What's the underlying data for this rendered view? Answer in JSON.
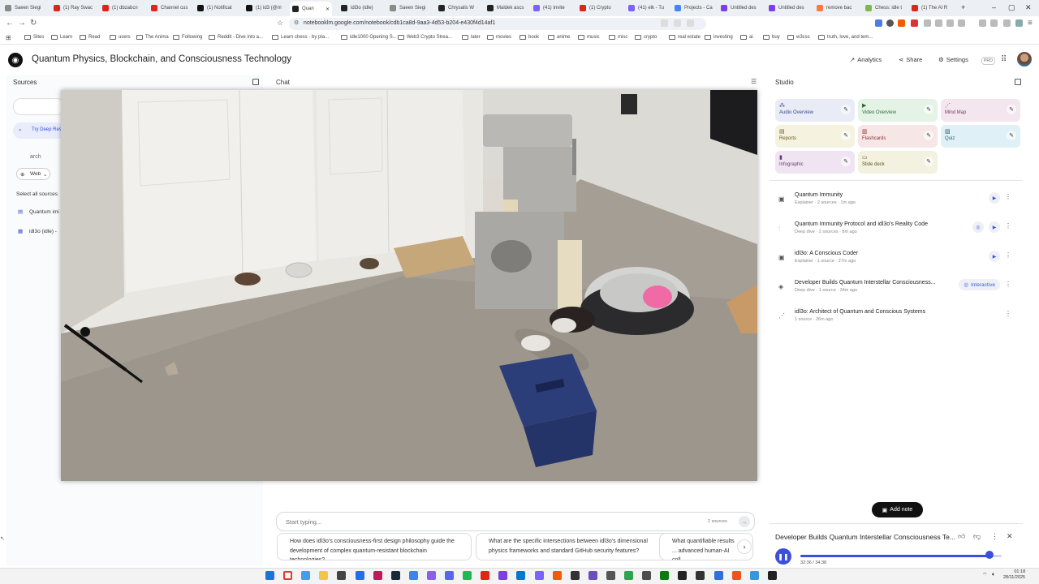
{
  "browser": {
    "tabs": [
      {
        "label": "Saeen Siegi",
        "color": "#8a8a8a"
      },
      {
        "label": "(1) Ray Swac",
        "color": "#e62117"
      },
      {
        "label": "(1) dbzabcn",
        "color": "#e62117"
      },
      {
        "label": "Channel cus",
        "color": "#e62117"
      },
      {
        "label": "(1) Notificat",
        "color": "#111111"
      },
      {
        "label": "(1) id3 (@m",
        "color": "#111111"
      },
      {
        "label": "Quan",
        "color": "#222222"
      },
      {
        "label": "idl3o (idle)",
        "color": "#222222"
      },
      {
        "label": "Saeen Siegi",
        "color": "#8a8a8a"
      },
      {
        "label": "Chrysalis W",
        "color": "#222222"
      },
      {
        "label": "Maldek ascs",
        "color": "#222222"
      },
      {
        "label": "(41) Invite",
        "color": "#7b61ff"
      },
      {
        "label": "(1) Crypto",
        "color": "#e62117"
      },
      {
        "label": "(41) elk - Tu",
        "color": "#7b61ff"
      },
      {
        "label": "Projects - Ca",
        "color": "#4285f4"
      },
      {
        "label": "Untitled des",
        "color": "#7b3fe4"
      },
      {
        "label": "Untitled des",
        "color": "#7b3fe4"
      },
      {
        "label": "remove bac",
        "color": "#ff7a3d"
      },
      {
        "label": "Chess: idle t",
        "color": "#81b64c"
      },
      {
        "label": "(1) The AI R",
        "color": "#e62117"
      }
    ],
    "url": "notebooklm.google.com/notebook/cdb1ca8d-9aa3-4d53-b204-e430f4d14af1",
    "bookmarks": [
      "Sites",
      "Learn",
      "Read",
      "users",
      "The Anima",
      "Following",
      "Reddit - Dive into a...",
      "Learn chess - by pla...",
      "idle1000 Opening S...",
      "Web3 Crypto Strea...",
      "later",
      "movies",
      "book",
      "anime",
      "music",
      "misc",
      "crypto",
      "real estate",
      "investing",
      "ai",
      "buy",
      "w3css",
      "truth, love, and tem..."
    ]
  },
  "app": {
    "title": "Quantum Physics, Blockchain, and Consciousness Technology",
    "analytics": "Analytics",
    "share": "Share",
    "settings": "Settings",
    "pro": "PRO"
  },
  "sources": {
    "title": "Sources",
    "try_deep": "Try Deep Res",
    "search_ph": "arch",
    "web": "Web",
    "select_all": "Select all sources",
    "items": [
      "Quantum imi",
      "idl3o (idle) -"
    ]
  },
  "chat": {
    "title": "Chat",
    "input_placeholder": "Start typing...",
    "source_count": "2 sources",
    "suggestions": [
      "How does idl3o's consciousness-first design philosophy guide the development of complex quantum-resistant blockchain technologies?",
      "What are the specific intersections between idl3o's dimensional physics frameworks and standard GitHub security features?",
      "What quantifiable results ... advanced human-AI coll..."
    ]
  },
  "studio": {
    "title": "Studio",
    "cards": [
      {
        "label": "Audio Overview",
        "bg": "#e9ebf7",
        "fg": "#3b4a8a"
      },
      {
        "label": "Video Overview",
        "bg": "#e4f3e6",
        "fg": "#2f6b3a"
      },
      {
        "label": "Mind Map",
        "bg": "#f3e6ee",
        "fg": "#7a3b5a"
      },
      {
        "label": "Reports",
        "bg": "#f5f2e0",
        "fg": "#6b5e22"
      },
      {
        "label": "Flashcards",
        "bg": "#f7e6e6",
        "fg": "#8a3030"
      },
      {
        "label": "Quiz",
        "bg": "#dff0f6",
        "fg": "#2a5f73"
      },
      {
        "label": "Infographic",
        "bg": "#f0e4f2",
        "fg": "#6b3a78"
      },
      {
        "label": "Slide deck",
        "bg": "#f3f1df",
        "fg": "#5e5722"
      }
    ],
    "artifacts": [
      {
        "title": "Quantum Immunity",
        "sub": "Explainer · 2 sources · 1m ago"
      },
      {
        "title": "Quantum Immunity Protocol and idl3o's Reality Code",
        "sub": "Deep dive · 2 sources · 8m ago"
      },
      {
        "title": "idl3o: A Conscious Coder",
        "sub": "Explainer · 1 source · 27m ago"
      },
      {
        "title": "Developer Builds Quantum Interstellar Consciousness...",
        "sub": "Deep dive · 1 source · 34m ago",
        "badge": "Interactive"
      },
      {
        "title": "idl3o: Architect of Quantum and Conscious Systems",
        "sub": "1 source · 26m ago"
      }
    ],
    "add_note": "Add note"
  },
  "player": {
    "title": "Developer Builds Quantum Interstellar Consciousness Te...",
    "time": "32:36 / 34:38",
    "progress": 0.94
  },
  "taskbar": {
    "time": "01:18",
    "date": "28/11/2025"
  }
}
